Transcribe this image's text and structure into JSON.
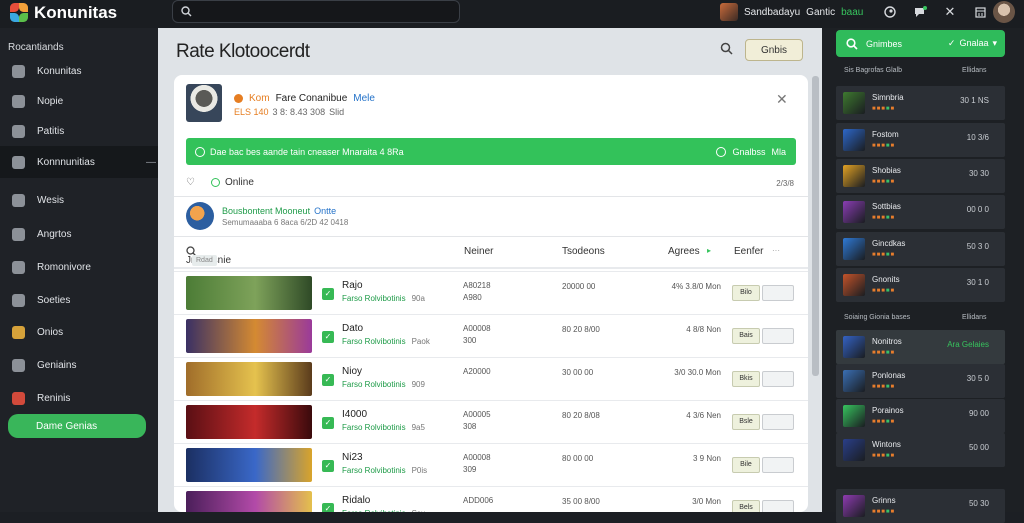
{
  "app": {
    "name": "Konunitas",
    "logo_colors": [
      "#e94e3b",
      "#f3a13a",
      "#3aa8e0",
      "#5bbf4a"
    ]
  },
  "top": {
    "search_placeholder": "",
    "user_name": "Sandbadayu",
    "user_status": "Gantic",
    "user_status_extra": "baau",
    "icons": [
      "steam-icon",
      "chat-icon",
      "close-icon",
      "calendar-icon"
    ]
  },
  "sidebar": {
    "section": "Rocantiands",
    "items": [
      {
        "label": "Konunitas",
        "icon": "globe-icon",
        "color": "#8c9198"
      },
      {
        "label": "Nopie",
        "icon": "pencil-icon",
        "color": "#8c9198"
      },
      {
        "label": "Patitis",
        "icon": "paint-icon",
        "color": "#8c9198"
      },
      {
        "label": "Konnnunitias",
        "icon": "grid-icon",
        "color": "#8c9198",
        "active": true
      },
      {
        "label": "Wesis",
        "icon": "user-icon",
        "color": "#8c9198"
      },
      {
        "label": "Angrtos",
        "icon": "news-icon",
        "color": "#8c9198"
      },
      {
        "label": "Romonivore",
        "icon": "lock-icon",
        "color": "#8c9198"
      },
      {
        "label": "Soeties",
        "icon": "chart-icon",
        "color": "#8c9198"
      },
      {
        "label": "Onios",
        "icon": "sun-icon",
        "color": "#d6a23a"
      },
      {
        "label": "Geniains",
        "icon": "globe-icon",
        "color": "#8c9198"
      },
      {
        "label": "Reninis",
        "icon": "flag-icon",
        "color": "#d24a3b"
      }
    ],
    "button_label": "Dame Genias"
  },
  "main": {
    "title": "Rate Klotoocerdt",
    "filter_label": "Gnbis",
    "profile": {
      "badge": "Kom",
      "name": "Fare Conanibue",
      "tag": "Mele",
      "line2_a": "ELS 140",
      "line2_b": "3 8: 8.43 308",
      "line2_c": "Slid"
    },
    "banner": {
      "text": "Dae bac bes aande tain cneaser Mnaraita 4 8Ra",
      "right_label": "Gnalbss",
      "right_tag": "Mla"
    },
    "online": {
      "label": "Online",
      "count": "2/3/8"
    },
    "sub": {
      "title": "Bousbontent Mooneut",
      "tag": "Ontte",
      "line2": "Semumaaaba 6 8aca 6/2D 42 0418"
    },
    "columns": {
      "name": "Jnlntosnie",
      "chip": "Rdad",
      "c1": "Neiner",
      "c2": "Tsodeons",
      "c3": "Agrees",
      "c4": "Eenfer"
    },
    "rows": [
      {
        "name": "Rajo",
        "genre": "Farso Rolvibotinis",
        "extra": "90a",
        "c1a": "A80218",
        "c1b": "A980",
        "c2": "20000 00",
        "c3": "4% 3.8/0 Mon",
        "btn": "Bilo",
        "thumb": [
          "#4c7c36",
          "#7ea25a",
          "#2f4a27"
        ]
      },
      {
        "name": "Dato",
        "genre": "Farso Rolvibotinis",
        "extra": "Paok",
        "c1a": "A00008",
        "c1b": "300",
        "c2": "80 20 8/00",
        "c3": "4 8/8 Non",
        "btn": "Bais",
        "thumb": [
          "#3a3064",
          "#d48a32",
          "#9a3a9a"
        ]
      },
      {
        "name": "Nioy",
        "genre": "Farso Rolvibotinis",
        "extra": "909",
        "c1a": "A20000",
        "c1b": "",
        "c2": "30 00 00",
        "c3": "3/0 30.0 Mon",
        "btn": "Bkis",
        "thumb": [
          "#a06d2a",
          "#e5c24e",
          "#5a3b1c"
        ]
      },
      {
        "name": "I4000",
        "genre": "Farso Rolvibotinis",
        "extra": "9a5",
        "c1a": "A00005",
        "c1b": "308",
        "c2": "80 20 8/08",
        "c3": "4 3/6 Nen",
        "btn": "Bsle",
        "thumb": [
          "#5a0f14",
          "#c42b2b",
          "#3a0a0c"
        ]
      },
      {
        "name": "Ni23",
        "genre": "Farso Rolvibotinis",
        "extra": "P0is",
        "c1a": "A00008",
        "c1b": "309",
        "c2": "80 00 00",
        "c3": "3 9 Non",
        "btn": "Bile",
        "thumb": [
          "#1b2f62",
          "#3a68c8",
          "#d9a42b"
        ]
      },
      {
        "name": "Ridalo",
        "genre": "Farso Rolvibotinis",
        "extra": "Ssu",
        "c1a": "ADD006",
        "c1b": "",
        "c2": "35 00 8/00",
        "c3": "3/0 Mon",
        "btn": "Bels",
        "thumb": [
          "#4b1f5a",
          "#b24aa8",
          "#e4c04c"
        ]
      }
    ]
  },
  "rightpanel": {
    "top_label": "Gnimbes",
    "top_right": "Gnalaa",
    "head1": {
      "left": "Sis Bagrofas Glalb",
      "right": "Ellidans"
    },
    "head2": {
      "left": "Soiaing Gionia bases",
      "right": "Ellidans"
    },
    "items": [
      {
        "name": "Simnbria",
        "val": "30 1 NS",
        "color": "#3e7a2f"
      },
      {
        "name": "Fostom",
        "val": "10 3/6",
        "color": "#2d67c9"
      },
      {
        "name": "Shobias",
        "val": "30 30",
        "color": "#e3a224"
      },
      {
        "name": "Sottbias",
        "val": "00 0 0",
        "color": "#8a3db3"
      },
      {
        "name": "Gincdkas",
        "val": "50 3 0",
        "color": "#2f7ad6"
      },
      {
        "name": "Gnonits",
        "val": "30 1 0",
        "color": "#c4532a"
      },
      {
        "name": "Nonitros",
        "val": "Ara Gelaies",
        "color": "#3462c4",
        "hl": true
      },
      {
        "name": "Ponlonas",
        "val": "30 5 0",
        "color": "#3a6fb4"
      },
      {
        "name": "Porainos",
        "val": "90 00",
        "color": "#37c45e"
      },
      {
        "name": "Wintons",
        "val": "50 00",
        "color": "#2a3f8a"
      },
      {
        "name": "Grinns",
        "val": "50 30",
        "color": "#8e3bb0"
      }
    ]
  }
}
